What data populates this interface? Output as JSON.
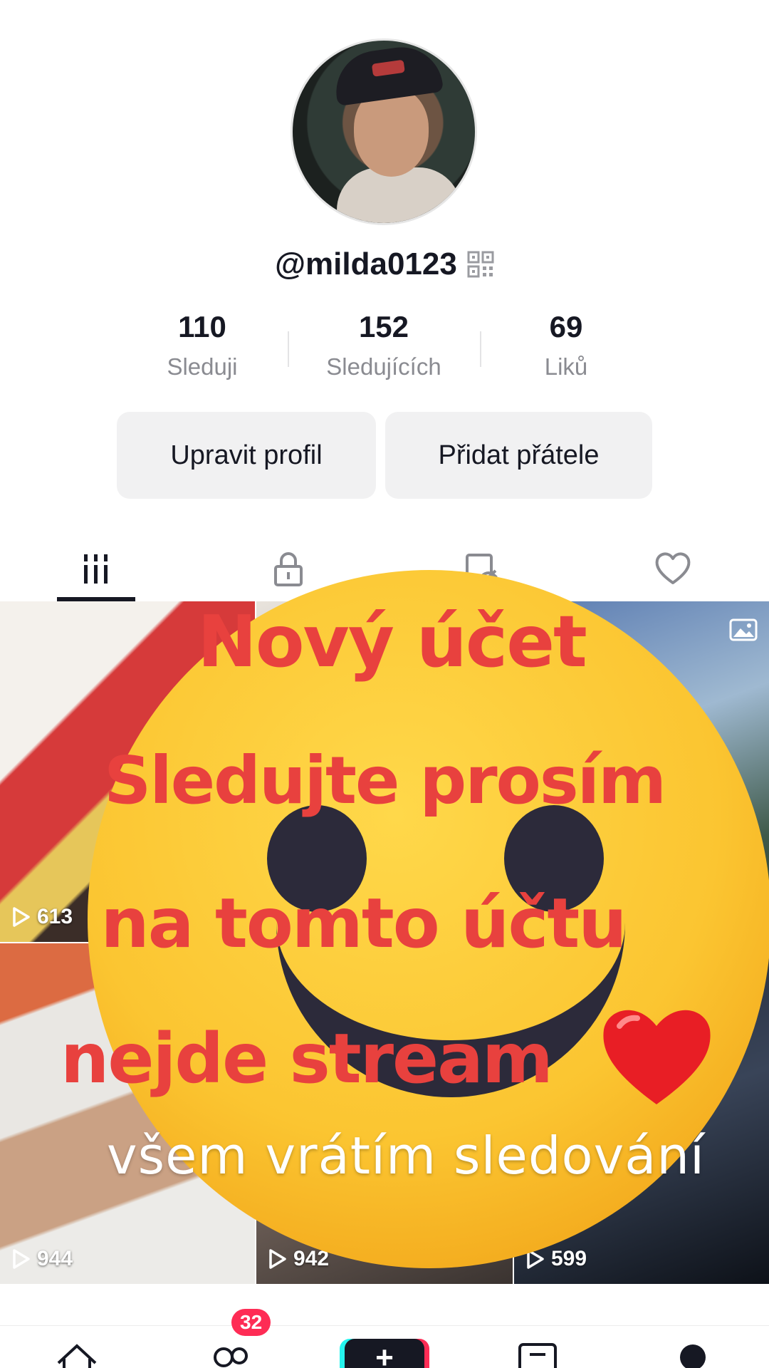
{
  "profile": {
    "username": "@milda0123",
    "stats": [
      {
        "value": "110",
        "label": "Sleduji"
      },
      {
        "value": "152",
        "label": "Sledujících"
      },
      {
        "value": "69",
        "label": "Liků"
      }
    ],
    "edit_button": "Upravit profil",
    "add_friends_button": "Přidat přátele"
  },
  "tabs": [
    {
      "icon": "grid-icon",
      "active": true
    },
    {
      "icon": "lock-icon",
      "active": false
    },
    {
      "icon": "reposts-hidden-icon",
      "active": false
    },
    {
      "icon": "heart-outline-icon",
      "active": false
    }
  ],
  "videos": [
    {
      "views": "613"
    },
    {
      "views": ""
    },
    {
      "views": "",
      "icon": "photo-icon"
    },
    {
      "views": "944"
    },
    {
      "views": "942"
    },
    {
      "views": "599"
    }
  ],
  "overlay": {
    "line1": "Nový účet",
    "line2": "Sledujte prosím",
    "line3": "na tomto účtu",
    "line4": "nejde stream",
    "line5": "všem vrátím sledování",
    "emoji": "smiley-face",
    "heart_icon": "red-heart-icon",
    "text_color": "#e8413e"
  },
  "bottom_nav": {
    "inbox_badge": "32",
    "items": [
      "home-icon",
      "friends-icon",
      "create-icon",
      "inbox-icon",
      "profile-icon"
    ],
    "accent_colors": [
      "#25f4ee",
      "#fe2c55"
    ]
  }
}
